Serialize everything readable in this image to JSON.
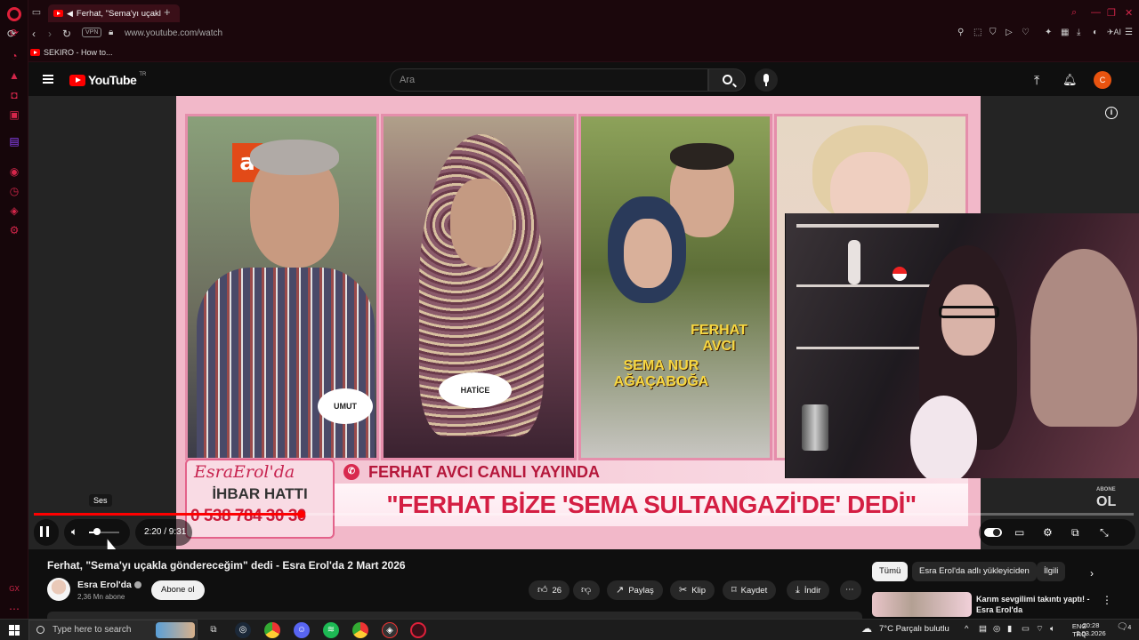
{
  "browser": {
    "tab_title": "Ferhat, \"Sema'yı uçakl",
    "vpn_label": "VPN",
    "url": "www.youtube.com/watch",
    "bookmark": "SEKIRO - How to...",
    "ai_label": "AI",
    "new_tab": "+"
  },
  "youtube": {
    "region": "TR",
    "logo_text": "YouTube",
    "search_placeholder": "Ara",
    "avatar_letter": "C"
  },
  "video": {
    "panel_badges": [
      "UMUT",
      "HATİCE"
    ],
    "caption_sema": "SEMA NUR AĞAÇABOĞA",
    "caption_ferhat": "FERHAT AVCI",
    "channel_logo": "EsraErol'da",
    "ihbar": "İHBAR HATTI",
    "phone": "0 538 784 30 30",
    "live_banner": "FERHAT AVCI CANLI YAYINDA",
    "headline": "\"FERHAT BİZE 'SEMA SULTANGAZİ'DE' DEDİ\"",
    "bone_ol": "OL",
    "bone_small": "ABONE"
  },
  "player": {
    "progress": 0.243,
    "volume": 0.25,
    "time": "2:20 / 9:31",
    "tooltip": "Ses"
  },
  "meta": {
    "title": "Ferhat, \"Sema'yı uçakla göndereceğim\" dedi - Esra Erol'da 2 Mart 2026",
    "channel": "Esra Erol'da",
    "subscribers": "2,36 Mn abone",
    "subscribe": "Abone ol",
    "likes": "26",
    "share": "Paylaş",
    "clip": "Klip",
    "save": "Kaydet",
    "download": "İndir"
  },
  "chips": [
    "Tümü",
    "Esra Erol'da adlı yükleyiciden",
    "İlgili"
  ],
  "recommended": {
    "title": "Karım sevgilimi takıntı yaptı! - Esra Erol'da"
  },
  "taskbar": {
    "search": "Type here to search",
    "weather": "7°C  Parçalı bulutlu",
    "lang1": "ENG",
    "lang2": "TRQ",
    "clock": "20:28",
    "date": "2.03.2026",
    "notif": "4"
  },
  "colors": {
    "accent": "#ff0000",
    "opera": "#e0203a",
    "banner": "#d41e43"
  }
}
